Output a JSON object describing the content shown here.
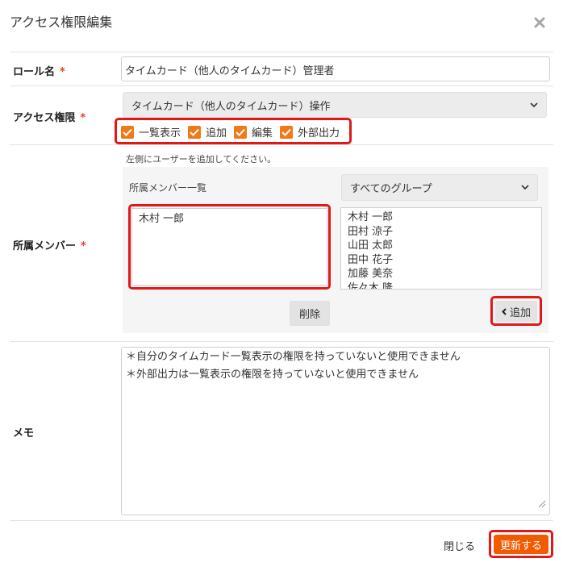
{
  "dialog": {
    "title": "アクセス権限編集"
  },
  "role": {
    "label": "ロール名",
    "required": "*",
    "value": "タイムカード（他人のタイムカード）管理者"
  },
  "access": {
    "label": "アクセス権限",
    "required": "*",
    "selected": "タイムカード（他人のタイムカード）操作",
    "checkboxes": [
      {
        "label": "一覧表示",
        "checked": true
      },
      {
        "label": "追加",
        "checked": true
      },
      {
        "label": "編集",
        "checked": true
      },
      {
        "label": "外部出力",
        "checked": true
      }
    ]
  },
  "members": {
    "label": "所属メンバー",
    "required": "*",
    "hint": "左側にユーザーを追加してください。",
    "list_label": "所属メンバー一覧",
    "group_select": "すべてのグループ",
    "selected_members": [
      "木村 一郎"
    ],
    "available_members": [
      "木村 一郎",
      "田村 涼子",
      "山田 太郎",
      "田中 花子",
      "加藤 美奈",
      "佐々木 隆"
    ],
    "delete_label": "削除",
    "add_label": "追加"
  },
  "memo": {
    "label": "メモ",
    "lines": [
      "＊自分のタイムカード一覧表示の権限を持っていないと使用できません",
      "＊外部出力は一覧表示の権限を持っていないと使用できません"
    ]
  },
  "footer": {
    "close_label": "閉じる",
    "update_label": "更新する"
  },
  "colors": {
    "accent": "#f25a00",
    "checkbox": "#f07a1a",
    "highlight": "#e01818",
    "required": "#e8402a"
  }
}
